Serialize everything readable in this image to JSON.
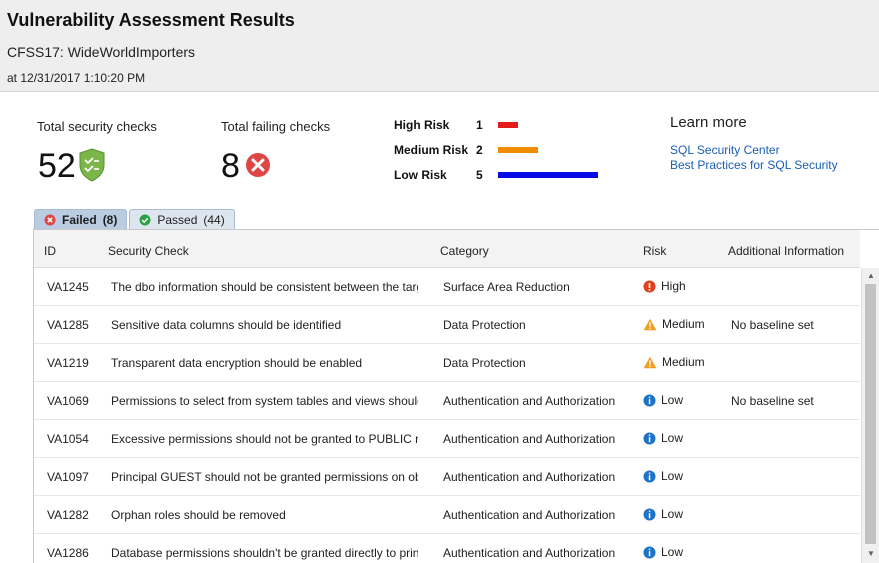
{
  "header": {
    "title": "Vulnerability Assessment Results",
    "subtitle": "CFSS17: WideWorldImporters",
    "timestamp": "at 12/31/2017 1:10:20 PM"
  },
  "summary": {
    "total_checks_label": "Total security checks",
    "total_checks_value": "52",
    "failing_checks_label": "Total failing checks",
    "failing_checks_value": "8"
  },
  "risk_summary": [
    {
      "name": "High Risk",
      "count": "1",
      "color": "#e31b1b",
      "fraction": 0.2
    },
    {
      "name": "Medium Risk",
      "count": "2",
      "color": "#f08c00",
      "fraction": 0.4
    },
    {
      "name": "Low Risk",
      "count": "5",
      "color": "#0a0ae8",
      "fraction": 1.0
    }
  ],
  "learn_more": {
    "title": "Learn more",
    "links": [
      "SQL Security Center",
      "Best Practices for SQL Security"
    ]
  },
  "tabs": [
    {
      "label": "Failed",
      "count": "(8)",
      "icon": "error-circle-icon",
      "active": true
    },
    {
      "label": "Passed",
      "count": "(44)",
      "icon": "check-circle-icon",
      "active": false
    }
  ],
  "table": {
    "columns": [
      "ID",
      "Security Check",
      "Category",
      "Risk",
      "Additional Information"
    ],
    "rows": [
      {
        "id": "VA1245",
        "check": "The dbo information should be consistent between the target",
        "category": "Surface Area Reduction",
        "risk": "High",
        "info": ""
      },
      {
        "id": "VA1285",
        "check": "Sensitive data columns should be identified",
        "category": "Data Protection",
        "risk": "Medium",
        "info": "No baseline set"
      },
      {
        "id": "VA1219",
        "check": "Transparent data encryption should be enabled",
        "category": "Data Protection",
        "risk": "Medium",
        "info": ""
      },
      {
        "id": "VA1069",
        "check": "Permissions to select from system tables and views should be revoked",
        "category": "Authentication and Authorization",
        "risk": "Low",
        "info": "No baseline set"
      },
      {
        "id": "VA1054",
        "check": "Excessive permissions should not be granted to PUBLIC role",
        "category": "Authentication and Authorization",
        "risk": "Low",
        "info": ""
      },
      {
        "id": "VA1097",
        "check": "Principal GUEST should not be granted permissions on objects",
        "category": "Authentication and Authorization",
        "risk": "Low",
        "info": ""
      },
      {
        "id": "VA1282",
        "check": "Orphan roles should be removed",
        "category": "Authentication and Authorization",
        "risk": "Low",
        "info": ""
      },
      {
        "id": "VA1286",
        "check": "Database permissions shouldn't be granted directly to principals",
        "category": "Authentication and Authorization",
        "risk": "Low",
        "info": ""
      }
    ]
  },
  "colors": {
    "high": "#e2401c",
    "medium": "#f0a020",
    "low": "#1e72c8",
    "shield": "#7ab648",
    "fail": "#e04545",
    "pass": "#2ea043"
  }
}
